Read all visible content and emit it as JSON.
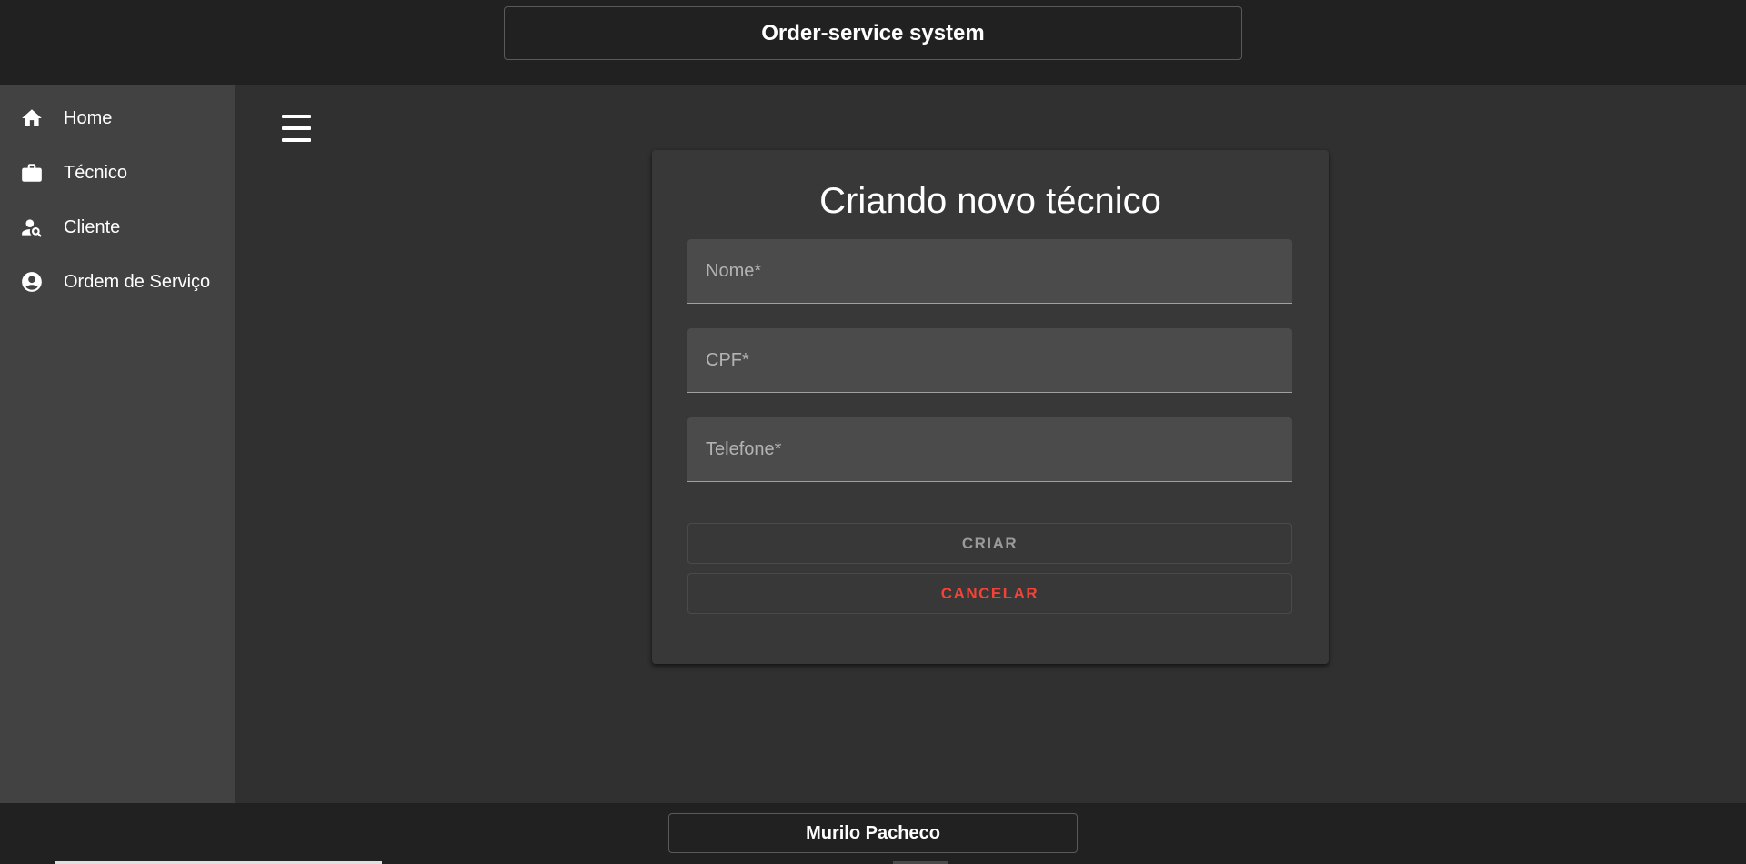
{
  "header": {
    "title": "Order-service system"
  },
  "sidebar": {
    "items": [
      {
        "label": "Home",
        "icon": "home-icon"
      },
      {
        "label": "Técnico",
        "icon": "briefcase-icon"
      },
      {
        "label": "Cliente",
        "icon": "person-search-icon"
      },
      {
        "label": "Ordem de Serviço",
        "icon": "account-circle-icon"
      }
    ]
  },
  "main": {
    "menu_icon": "menu-icon"
  },
  "form": {
    "title": "Criando novo técnico",
    "fields": {
      "nome": {
        "placeholder": "Nome*",
        "value": ""
      },
      "cpf": {
        "placeholder": "CPF*",
        "value": ""
      },
      "telefone": {
        "placeholder": "Telefone*",
        "value": ""
      }
    },
    "create_label": "CRIAR",
    "cancel_label": "CANCELAR"
  },
  "footer": {
    "author": "Murilo Pacheco"
  },
  "colors": {
    "background": "#303030",
    "header": "#212121",
    "sidebar": "#424242",
    "card": "#383838",
    "field": "#4b4b4b",
    "cancel": "#f44336"
  }
}
